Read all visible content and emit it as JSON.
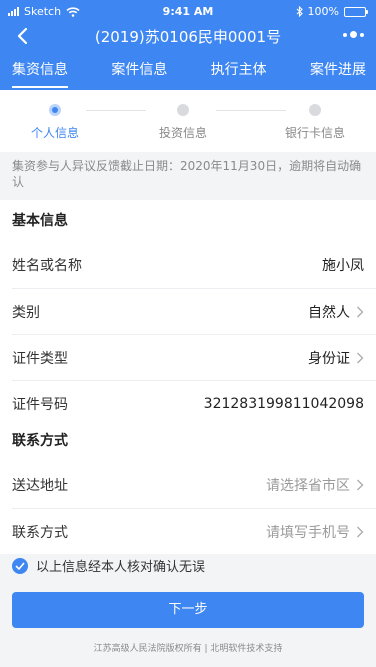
{
  "status_bar": {
    "carrier": "Sketch",
    "time": "9:41 AM",
    "battery": "100%"
  },
  "nav": {
    "title": "(2019)苏0106民申0001号"
  },
  "tabs": [
    {
      "label": "集资信息",
      "active": true
    },
    {
      "label": "案件信息",
      "active": false
    },
    {
      "label": "执行主体",
      "active": false
    },
    {
      "label": "案件进展",
      "active": false
    }
  ],
  "steps": [
    {
      "label": "个人信息",
      "active": true
    },
    {
      "label": "投资信息",
      "active": false
    },
    {
      "label": "银行卡信息",
      "active": false
    }
  ],
  "notice": "集资参与人异议反馈截止日期：2020年11月30日，逾期将自动确认",
  "basic": {
    "heading": "基本信息",
    "name": {
      "label": "姓名或名称",
      "value": "施小凤"
    },
    "category": {
      "label": "类别",
      "value": "自然人"
    },
    "id_type": {
      "label": "证件类型",
      "value": "身份证"
    },
    "id_number": {
      "label": "证件号码",
      "value": "321283199811042098"
    }
  },
  "contact": {
    "heading": "联系方式",
    "address": {
      "label": "送达地址",
      "placeholder": "请选择省市区"
    },
    "phone": {
      "label": "联系方式",
      "placeholder": "请填写手机号"
    }
  },
  "confirm": {
    "text": "以上信息经本人核对确认无误",
    "checked": true
  },
  "next_button": "下一步",
  "footer": "江苏高级人民法院版权所有 | 北明软件技术支持",
  "colors": {
    "primary": "#3e86f1",
    "background": "#f3f4f6"
  }
}
